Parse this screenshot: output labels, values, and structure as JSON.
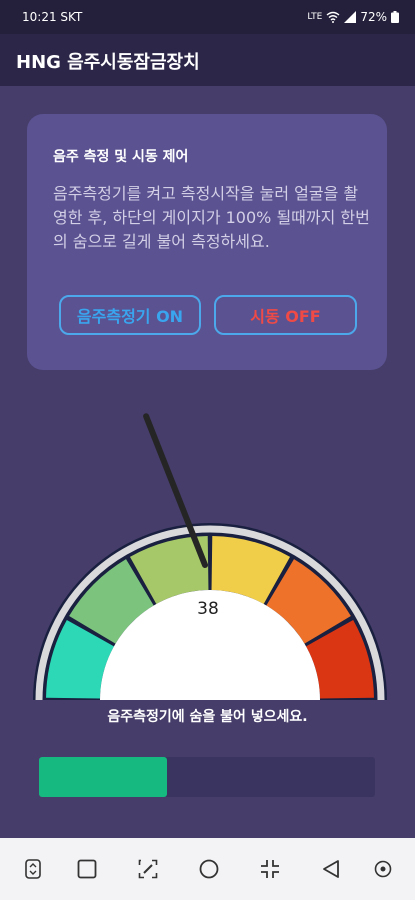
{
  "status_bar": {
    "time": "10:21",
    "carrier": "SKT",
    "network": "LTE",
    "battery": "72%"
  },
  "app": {
    "title": "HNG 음주시동잠금장치"
  },
  "control_card": {
    "heading": "음주 측정 및 시동 제어",
    "description": "음주측정기를 켜고 측정시작을 눌러 얼굴을 촬영한 후, 하단의 게이지가 100% 될때까지 한번의 숨으로 길게 불어 측정하세요.",
    "on_button": "음주측정기 ON",
    "off_button": "시동 OFF"
  },
  "gauge": {
    "value": 38,
    "value_label": "38",
    "instruction": "음주측정기에 숨을 불어 넣으세요."
  },
  "progress": {
    "fraction": 0.38
  },
  "colors": {
    "segments": [
      "#2cd8b5",
      "#7cc37e",
      "#a7c868",
      "#f1ce4a",
      "#ee7229",
      "#da3614"
    ],
    "progress_fill": "#16b97f",
    "accent_on": "#3aa5ef",
    "accent_off": "#ef4a46"
  },
  "nav": {
    "icons": [
      "screen-switch-icon",
      "square-icon",
      "edit-icon",
      "circle-icon",
      "compress-icon",
      "back-triangle-icon",
      "dot-icon"
    ]
  }
}
